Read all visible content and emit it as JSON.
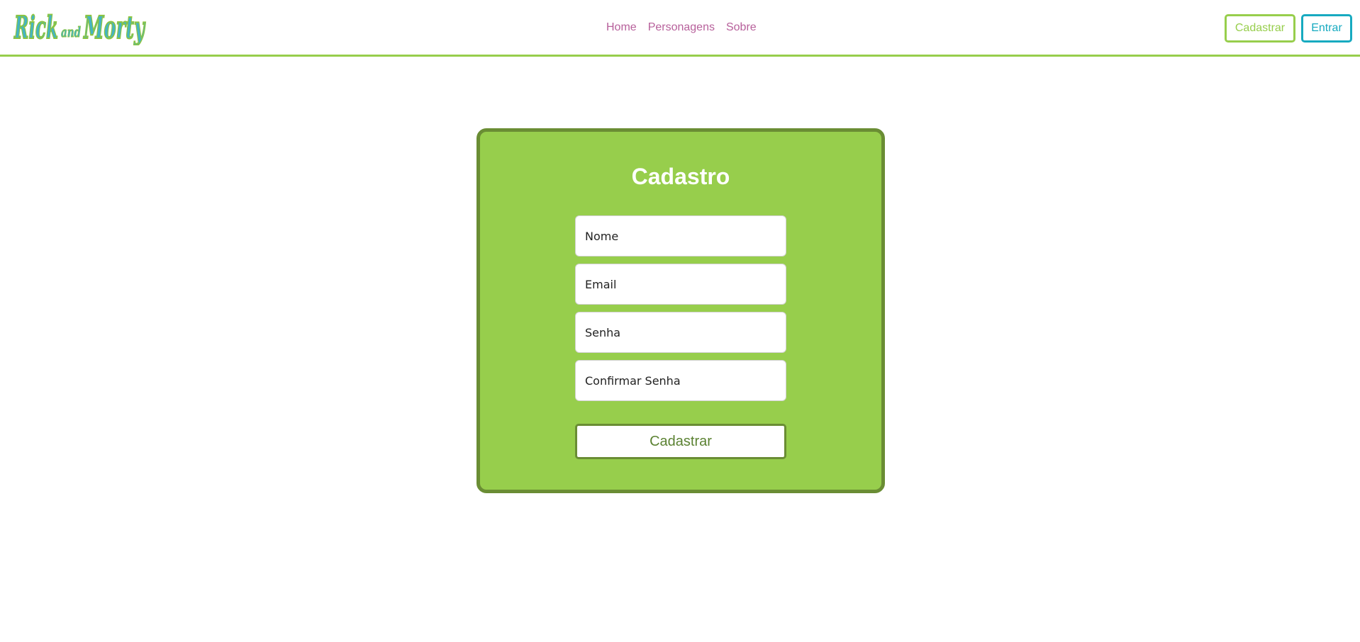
{
  "header": {
    "logo_text": "Rick and Morty",
    "nav": [
      "Home",
      "Personagens",
      "Sobre"
    ],
    "signup_label": "Cadastrar",
    "login_label": "Entrar"
  },
  "form": {
    "title": "Cadastro",
    "fields": [
      {
        "placeholder": "Nome"
      },
      {
        "placeholder": "Email"
      },
      {
        "placeholder": "Senha"
      },
      {
        "placeholder": "Confirmar Senha"
      }
    ],
    "submit_label": "Cadastrar"
  },
  "colors": {
    "green": "#97ce4c",
    "dark_green": "#6a8d34",
    "cyan": "#17aac0",
    "pink": "#b7609b"
  }
}
